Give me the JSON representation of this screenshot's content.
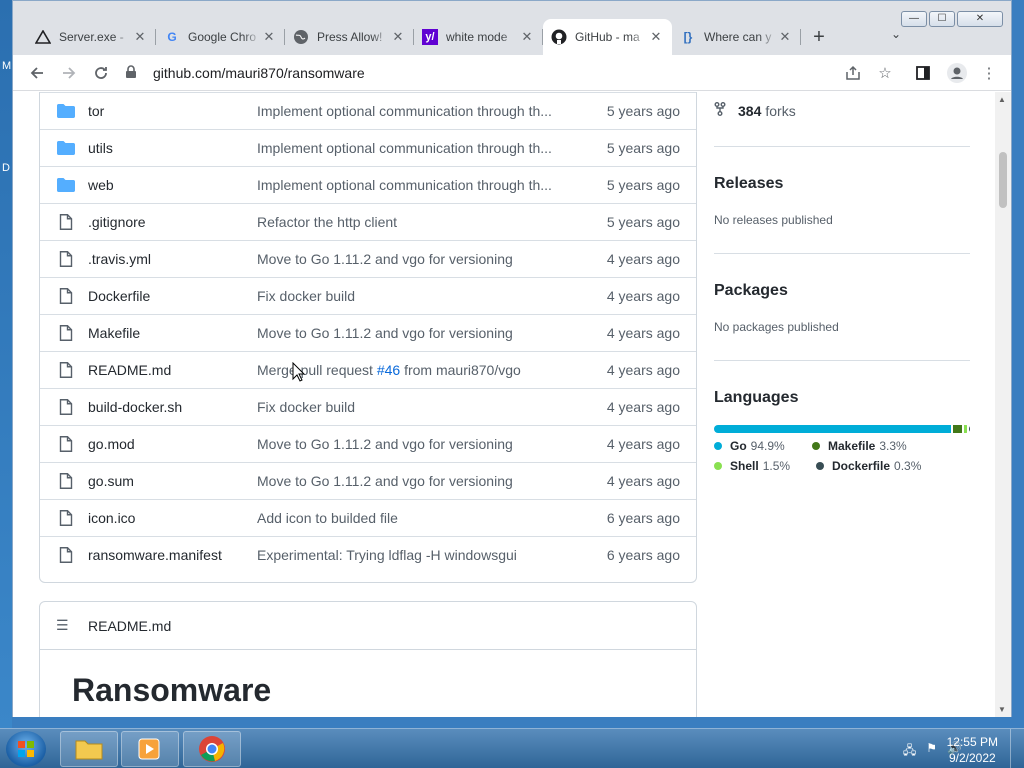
{
  "browser": {
    "tabs": [
      {
        "title": "Server.exe - ",
        "favicon": "server-favicon",
        "active": false
      },
      {
        "title": "Google Chro",
        "favicon": "google-favicon",
        "active": false
      },
      {
        "title": "Press Allow!",
        "favicon": "globe-favicon",
        "active": false
      },
      {
        "title": "white mode",
        "favicon": "yahoo-favicon",
        "active": false
      },
      {
        "title": "GitHub - ma",
        "favicon": "github-favicon",
        "active": true
      },
      {
        "title": "Where can y",
        "favicon": "code-favicon",
        "active": false
      }
    ],
    "url": "github.com/mauri870/ransomware",
    "window_controls": {
      "minimize": "—",
      "maximize": "☐",
      "close": "✕"
    }
  },
  "files": [
    {
      "type": "folder",
      "name": "tor",
      "message": "Implement optional communication through th...",
      "age": "5 years ago"
    },
    {
      "type": "folder",
      "name": "utils",
      "message": "Implement optional communication through th...",
      "age": "5 years ago"
    },
    {
      "type": "folder",
      "name": "web",
      "message": "Implement optional communication through th...",
      "age": "5 years ago"
    },
    {
      "type": "file",
      "name": ".gitignore",
      "message": "Refactor the http client",
      "age": "5 years ago"
    },
    {
      "type": "file",
      "name": ".travis.yml",
      "message": "Move to Go 1.11.2 and vgo for versioning",
      "age": "4 years ago"
    },
    {
      "type": "file",
      "name": "Dockerfile",
      "message": "Fix docker build",
      "age": "4 years ago"
    },
    {
      "type": "file",
      "name": "Makefile",
      "message": "Move to Go 1.11.2 and vgo for versioning",
      "age": "4 years ago"
    },
    {
      "type": "file",
      "name": "README.md",
      "message": "Merge pull request ",
      "message_link": "#46",
      "message_tail": " from mauri870/vgo",
      "age": "4 years ago"
    },
    {
      "type": "file",
      "name": "build-docker.sh",
      "message": "Fix docker build",
      "age": "4 years ago"
    },
    {
      "type": "file",
      "name": "go.mod",
      "message": "Move to Go 1.11.2 and vgo for versioning",
      "age": "4 years ago"
    },
    {
      "type": "file",
      "name": "go.sum",
      "message": "Move to Go 1.11.2 and vgo for versioning",
      "age": "4 years ago"
    },
    {
      "type": "file",
      "name": "icon.ico",
      "message": "Add icon to builded file",
      "age": "6 years ago"
    },
    {
      "type": "file",
      "name": "ransomware.manifest",
      "message": "Experimental: Trying ldflag -H windowsgui",
      "age": "6 years ago"
    }
  ],
  "readme": {
    "header": "README.md",
    "heading": "Ransomware"
  },
  "sidebar": {
    "forks_count": "384",
    "forks_label": "forks",
    "releases_title": "Releases",
    "releases_text": "No releases published",
    "packages_title": "Packages",
    "packages_text": "No packages published",
    "languages_title": "Languages",
    "languages": [
      {
        "name": "Go",
        "percent": "94.9%",
        "value": 94.9,
        "color": "#00ADD8"
      },
      {
        "name": "Makefile",
        "percent": "3.3%",
        "value": 3.3,
        "color": "#427819"
      },
      {
        "name": "Shell",
        "percent": "1.5%",
        "value": 1.5,
        "color": "#89e051"
      },
      {
        "name": "Dockerfile",
        "percent": "0.3%",
        "value": 0.3,
        "color": "#384d54"
      }
    ]
  },
  "taskbar": {
    "time": "12:55 PM",
    "date": "9/2/2022",
    "apps": [
      "file-explorer",
      "media-player",
      "chrome"
    ]
  }
}
